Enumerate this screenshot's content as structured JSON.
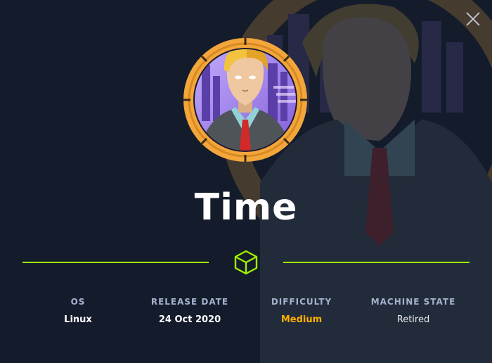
{
  "machine": {
    "name": "Time"
  },
  "stats": {
    "os": {
      "label": "OS",
      "value": "Linux"
    },
    "release_date": {
      "label": "RELEASE DATE",
      "value": "24 Oct 2020"
    },
    "difficulty": {
      "label": "DIFFICULTY",
      "value": "Medium"
    },
    "machine_state": {
      "label": "MACHINE STATE",
      "value": "Retired"
    }
  },
  "colors": {
    "background": "#141c2b",
    "accent_green": "#9fef00",
    "difficulty_medium": "#ffaf00",
    "avatar_ring": "#f5a93e",
    "label_gray": "#a4b1cd"
  },
  "icons": {
    "close": "close-icon",
    "divider": "cube-icon"
  }
}
